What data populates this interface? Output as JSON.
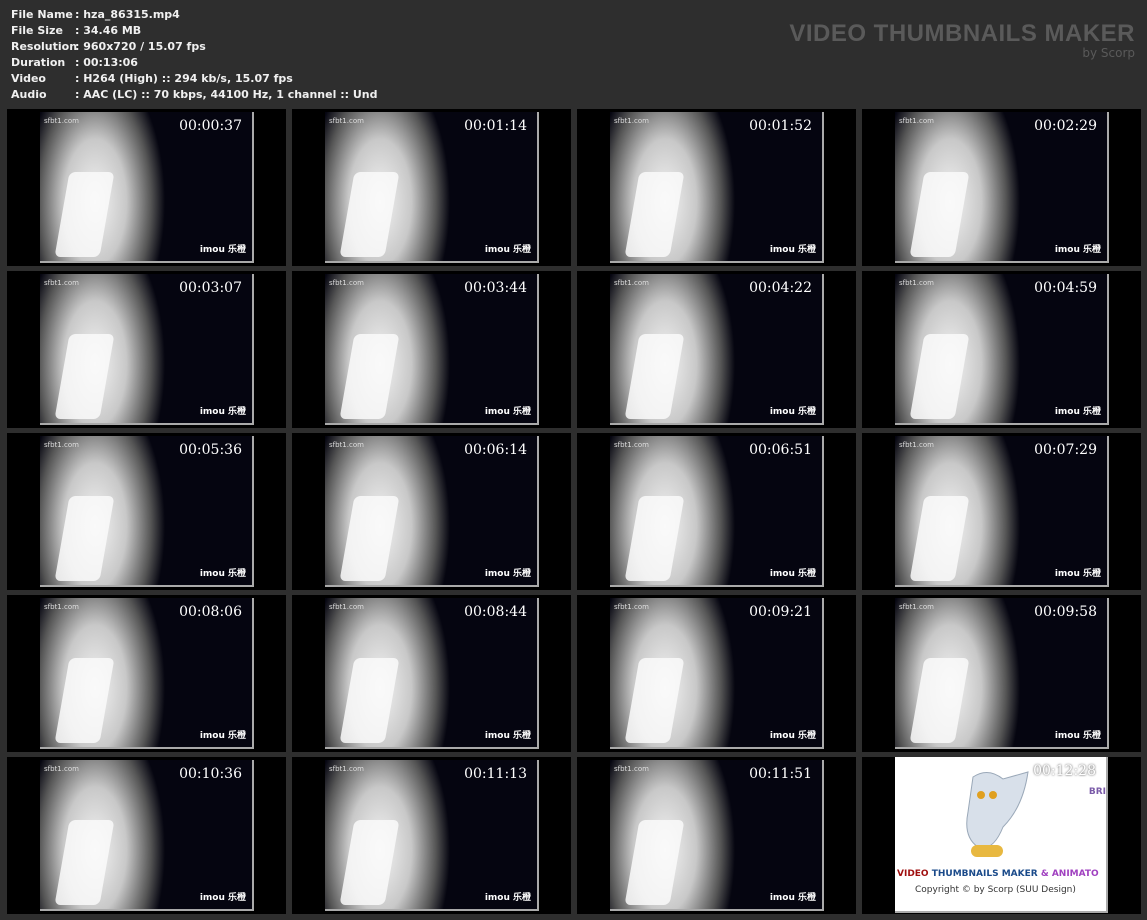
{
  "info": [
    {
      "label": "File Name",
      "value": ": hza_86315.mp4"
    },
    {
      "label": "File Size",
      "value": ": 34.46 MB"
    },
    {
      "label": "Resolution",
      "value": ": 960x720 / 15.07 fps"
    },
    {
      "label": "Duration",
      "value": ": 00:13:06"
    },
    {
      "label": "Video",
      "value": ": H264 (High) :: 294 kb/s, 15.07 fps"
    },
    {
      "label": "Audio",
      "value": ": AAC (LC) :: 70 kbps, 44100 Hz, 1 channel :: Und"
    }
  ],
  "brand": {
    "title": "VIDEO THUMBNAILS MAKER",
    "subtitle": "by Scorp"
  },
  "thumbs": [
    "00:00:37",
    "00:01:14",
    "00:01:52",
    "00:02:29",
    "00:03:07",
    "00:03:44",
    "00:04:22",
    "00:04:59",
    "00:05:36",
    "00:06:14",
    "00:06:51",
    "00:07:29",
    "00:08:06",
    "00:08:44",
    "00:09:21",
    "00:09:58",
    "00:10:36",
    "00:11:13",
    "00:11:51"
  ],
  "watermark": "imou 乐橙",
  "overlay": "sfbt1.com",
  "logo": {
    "time": "00:12:28",
    "bri": "BRI",
    "title_a": "VIDEO",
    "title_b": "THUMBNAILS MAKER",
    "title_c": "& ANIMATO",
    "copyright": "Copyright © by Scorp (SUU Design)"
  }
}
